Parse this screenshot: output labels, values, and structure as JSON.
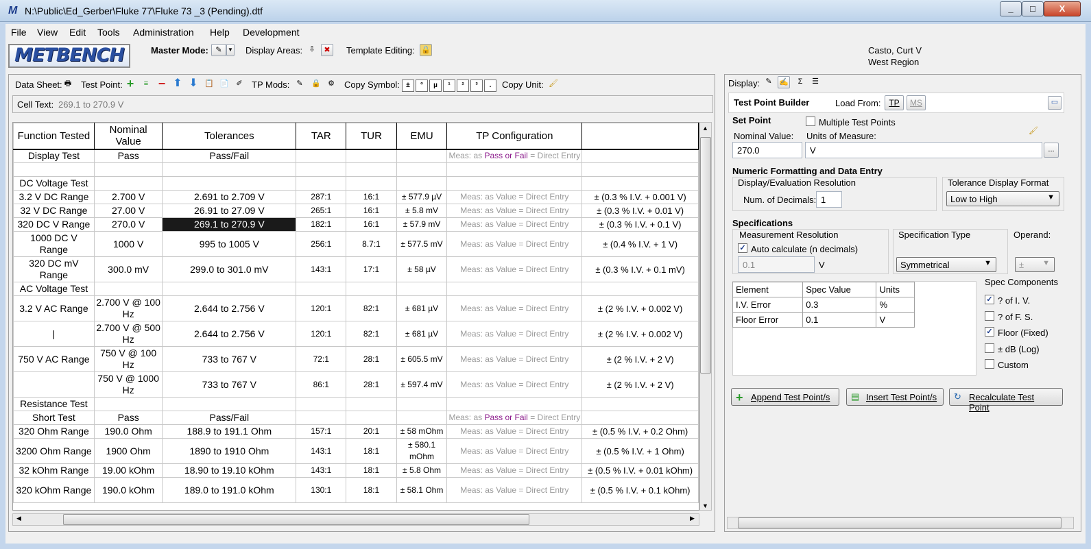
{
  "window": {
    "title": "N:\\Public\\Ed_Gerber\\Fluke 77\\Fluke 73 _3 (Pending).dtf"
  },
  "menu": [
    "File",
    "View",
    "Edit",
    "Tools",
    "Administration",
    "Help",
    "Development"
  ],
  "toolbar": {
    "logo_text": "METBENCH",
    "master_mode_label": "Master Mode:",
    "display_areas_label": "Display Areas:",
    "template_editing_label": "Template Editing:",
    "user_name": "Casto, Curt V",
    "region": "West Region"
  },
  "datasheet_toolbar": {
    "data_sheet_label": "Data Sheet:",
    "test_point_label": "Test Point:",
    "tp_mods_label": "TP Mods:",
    "copy_symbol_label": "Copy Symbol:",
    "copy_symbols": [
      "±",
      "°",
      "µ",
      "¹",
      "²",
      "³",
      "."
    ],
    "copy_unit_label": "Copy Unit:",
    "cell_text_label": "Cell Text:",
    "cell_text_value": "269.1 to 270.9 V"
  },
  "grid": {
    "headers": [
      "Function Tested",
      "Nominal Value",
      "Tolerances",
      "TAR",
      "TUR",
      "EMU",
      "TP Configuration",
      ""
    ],
    "rows": [
      {
        "fn": "Display Test",
        "nom": "Pass",
        "tol": "Pass/Fail",
        "tar": "",
        "tur": "",
        "emu": "",
        "tp": "passfail",
        "spec": ""
      },
      {
        "fn": "",
        "nom": "",
        "tol": "",
        "tar": "",
        "tur": "",
        "emu": "",
        "tp": "",
        "spec": ""
      },
      {
        "fn": "DC Voltage Test",
        "nom": "",
        "tol": "",
        "tar": "",
        "tur": "",
        "emu": "",
        "tp": "",
        "spec": "",
        "left": true
      },
      {
        "fn": "3.2 V DC Range",
        "nom": "2.700 V",
        "tol": "2.691 to 2.709 V",
        "tar": "287:1",
        "tur": "16:1",
        "emu": "± 577.9 µV",
        "tp": "Meas: as Value = Direct Entry",
        "spec": "± (0.3 % I.V. + 0.001 V)"
      },
      {
        "fn": "32 V DC Range",
        "nom": "27.00 V",
        "tol": "26.91 to 27.09 V",
        "tar": "265:1",
        "tur": "16:1",
        "emu": "± 5.8 mV",
        "tp": "Meas: as Value = Direct Entry",
        "spec": "± (0.3 % I.V. + 0.01 V)"
      },
      {
        "fn": "320 DC V Range",
        "nom": "270.0 V",
        "tol": "269.1 to 270.9 V",
        "tar": "182:1",
        "tur": "16:1",
        "emu": "± 57.9 mV",
        "tp": "Meas: as Value = Direct Entry",
        "spec": "± (0.3 % I.V. + 0.1 V)",
        "sel": true
      },
      {
        "fn": "1000 DC V Range",
        "nom": "1000 V",
        "tol": "995 to 1005 V",
        "tar": "256:1",
        "tur": "8.7:1",
        "emu": "± 577.5 mV",
        "tp": "Meas: as Value = Direct Entry",
        "spec": "± (0.4 % I.V. + 1 V)",
        "tall": true
      },
      {
        "fn": "320 DC mV Range",
        "nom": "300.0 mV",
        "tol": "299.0 to 301.0 mV",
        "tar": "143:1",
        "tur": "17:1",
        "emu": "± 58 µV",
        "tp": "Meas: as Value = Direct Entry",
        "spec": "± (0.3 % I.V. + 0.1 mV)",
        "tall": true
      },
      {
        "fn": "AC Voltage Test",
        "nom": "",
        "tol": "",
        "tar": "",
        "tur": "",
        "emu": "",
        "tp": "",
        "spec": "",
        "left": true
      },
      {
        "fn": "3.2 V AC Range",
        "nom": "2.700 V @ 100 Hz",
        "tol": "2.644 to 2.756 V",
        "tar": "120:1",
        "tur": "82:1",
        "emu": "± 681 µV",
        "tp": "Meas: as Value = Direct Entry",
        "spec": "± (2 % I.V. + 0.002 V)",
        "tall": true
      },
      {
        "fn": "|",
        "nom": "2.700 V @ 500 Hz",
        "tol": "2.644 to 2.756 V",
        "tar": "120:1",
        "tur": "82:1",
        "emu": "± 681 µV",
        "tp": "Meas: as Value = Direct Entry",
        "spec": "± (2 % I.V. + 0.002 V)",
        "tall": true
      },
      {
        "fn": "750 V AC Range",
        "nom": "750 V @ 100 Hz",
        "tol": "733 to 767 V",
        "tar": "72:1",
        "tur": "28:1",
        "emu": "± 605.5 mV",
        "tp": "Meas: as Value = Direct Entry",
        "spec": "± (2 % I.V. + 2 V)",
        "tall": true
      },
      {
        "fn": "",
        "nom": "750 V @ 1000 Hz",
        "tol": "733 to 767 V",
        "tar": "86:1",
        "tur": "28:1",
        "emu": "± 597.4 mV",
        "tp": "Meas: as Value = Direct Entry",
        "spec": "± (2 % I.V. + 2 V)",
        "tall": true
      },
      {
        "fn": "Resistance Test",
        "nom": "",
        "tol": "",
        "tar": "",
        "tur": "",
        "emu": "",
        "tp": "",
        "spec": "",
        "left": true
      },
      {
        "fn": "Short Test",
        "nom": "Pass",
        "tol": "Pass/Fail",
        "tar": "",
        "tur": "",
        "emu": "",
        "tp": "passfail",
        "spec": ""
      },
      {
        "fn": "320 Ohm Range",
        "nom": "190.0 Ohm",
        "tol": "188.9 to 191.1 Ohm",
        "tar": "157:1",
        "tur": "20:1",
        "emu": "± 58 mOhm",
        "tp": "Meas: as Value = Direct Entry",
        "spec": "± (0.5 % I.V. + 0.2 Ohm)"
      },
      {
        "fn": "3200 Ohm Range",
        "nom": "1900 Ohm",
        "tol": "1890 to 1910 Ohm",
        "tar": "143:1",
        "tur": "18:1",
        "emu": "± 580.1 mOhm",
        "tp": "Meas: as Value = Direct Entry",
        "spec": "± (0.5 % I.V. + 1 Ohm)",
        "tall": true
      },
      {
        "fn": "32 kOhm Range",
        "nom": "19.00 kOhm",
        "tol": "18.90 to 19.10 kOhm",
        "tar": "143:1",
        "tur": "18:1",
        "emu": "± 5.8 Ohm",
        "tp": "Meas: as Value = Direct Entry",
        "spec": "± (0.5 % I.V. + 0.01 kOhm)"
      },
      {
        "fn": "320 kOhm Range",
        "nom": "190.0 kOhm",
        "tol": "189.0 to 191.0 kOhm",
        "tar": "130:1",
        "tur": "18:1",
        "emu": "± 58.1 Ohm",
        "tp": "Meas: as Value = Direct Entry",
        "spec": "± (0.5 % I.V. + 0.1 kOhm)",
        "tall": true
      }
    ],
    "passfail": {
      "prefix": "Meas: as ",
      "pass": "Pass",
      "or": " or ",
      "fail": "Fail",
      "suffix": " = Direct Entry"
    }
  },
  "right": {
    "display_label": "Display:",
    "builder_title": "Test Point Builder",
    "load_from_label": "Load From:",
    "load_tp": "TP",
    "load_ms": "MS",
    "set_point_title": "Set Point",
    "multiple_test_points": "Multiple Test Points",
    "nominal_value_label": "Nominal Value:",
    "nominal_value": "270.0",
    "units_label": "Units of Measure:",
    "units_value": "V",
    "browse": "...",
    "numeric_title": "Numeric Formatting and Data Entry",
    "display_eval_res": "Display/Evaluation Resolution",
    "num_decimals_label": "Num. of Decimals:",
    "num_decimals": "1",
    "tol_display_format": "Tolerance Display Format",
    "tol_format_value": "Low to High",
    "specs_title": "Specifications",
    "meas_res": "Measurement Resolution",
    "auto_calc": "Auto calculate (n decimals)",
    "meas_res_value": "0.1",
    "meas_res_unit": "V",
    "spec_type_label": "Specification Type",
    "spec_type_value": "Symmetrical",
    "operand_label": "Operand:",
    "operand_value": "±",
    "spec_table_headers": [
      "Element",
      "Spec Value",
      "Units"
    ],
    "spec_rows": [
      [
        "I.V. Error",
        "0.3",
        "%"
      ],
      [
        "Floor Error",
        "0.1",
        "V"
      ]
    ],
    "spec_components_label": "Spec Components",
    "components": [
      {
        "label": "? of I. V.",
        "checked": true
      },
      {
        "label": "? of F. S.",
        "checked": false
      },
      {
        "label": "Floor (Fixed)",
        "checked": true
      },
      {
        "label": "± dB (Log)",
        "checked": false
      },
      {
        "label": "Custom",
        "checked": false
      }
    ],
    "append_btn": "Append Test Point/s",
    "insert_btn": "Insert Test Point/s",
    "recalc_btn": "Recalculate Test Point"
  }
}
